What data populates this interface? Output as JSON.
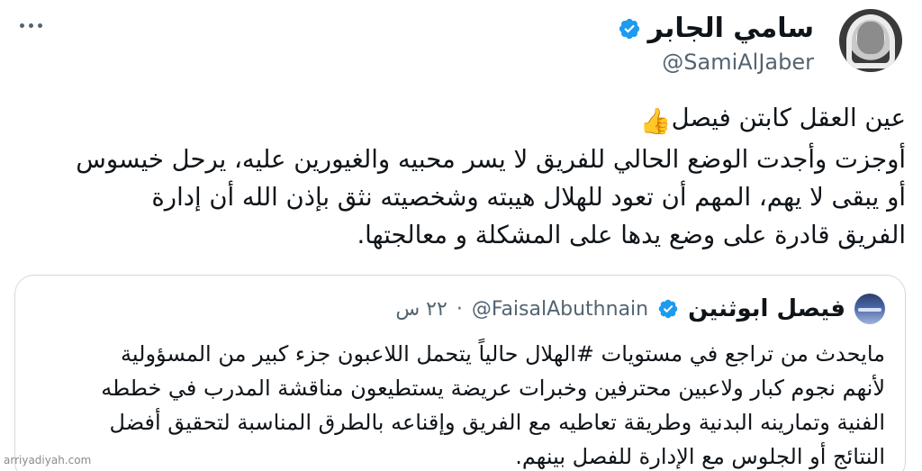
{
  "author": {
    "display_name": "سامي الجابر",
    "handle": "@SamiAlJaber"
  },
  "tweet": {
    "lines": [
      "عين العقل كابتن فيصل",
      "أوجزت وأجدت الوضع الحالي للفريق لا يسر محبيه والغيورين عليه، يرحل خيسوس",
      "أو يبقى لا يهم، المهم أن تعود للهلال هيبته وشخصيته نثق بإذن الله أن إدارة",
      "الفريق قادرة على وضع يدها على المشكلة و معالجتها."
    ]
  },
  "quoted_tweet": {
    "display_name": "فيصل ابوثنين",
    "handle": "@FaisalAbuthnain",
    "separator": "·",
    "time": "٢٢ س",
    "lines": [
      "مايحدث من تراجع في مستويات #الهلال حالياً يتحمل اللاعبون جزء كبير من المسؤولية",
      "لأنهم نجوم كبار ولاعبين محترفين وخبرات عريضة يستطيعون مناقشة المدرب في خططه",
      "الفنية وتمارينه البدنية وطريقة تعاطيه مع الفريق وإقناعه بالطرق المناسبة لتحقيق أفضل",
      "النتائج أو الجلوس مع الإدارة للفصل بينهم."
    ]
  },
  "watermark": "arriyadiyah.com",
  "icons": {
    "more": "more-options-icon",
    "verified": "verified-badge-icon",
    "thumbs_up": "thumbs-up-emoji"
  },
  "colors": {
    "verified_blue": "#1d9bf0",
    "muted_text": "#536471",
    "border": "#cfd9de"
  }
}
